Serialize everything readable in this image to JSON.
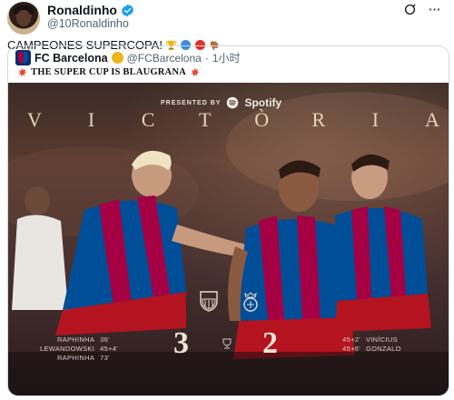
{
  "post": {
    "author_name": "Ronaldinho",
    "author_handle": "@10Ronaldinho",
    "text": "CAMPEONES SUPERCOPA!",
    "text_emojis": [
      "trophy-emoji",
      "blue-circle-emoji",
      "red-circle-emoji",
      "thumbs-down-emoji"
    ]
  },
  "quote": {
    "author_name": "FC Barcelona",
    "author_handle": "@FCBarcelona",
    "time": "1小时",
    "headline": "THE SUPER CUP IS BLAUGRANA"
  },
  "image": {
    "presented_by": "PRESENTED BY",
    "sponsor": "Spotify",
    "title_letters": [
      "V",
      "I",
      "C",
      "T",
      "Ò",
      "R",
      "I",
      "A"
    ],
    "home_score": "3",
    "away_score": "2",
    "home_scorers": [
      {
        "name": "RAPHINHA",
        "minute": "36'"
      },
      {
        "name": "LEWANDOWSKI",
        "minute": "45+4'"
      },
      {
        "name": "RAPHINHA",
        "minute": "73'"
      }
    ],
    "away_scorers": [
      {
        "minute": "45+2'",
        "name": "VINÍCIUS"
      },
      {
        "minute": "45+6'",
        "name": "GONZALO"
      }
    ]
  },
  "colors": {
    "verified": "#1d9bf0",
    "handle_gray": "#536471",
    "barca_blue": "#004d98",
    "barca_red": "#a50044",
    "spotify_green": "#1db954"
  }
}
